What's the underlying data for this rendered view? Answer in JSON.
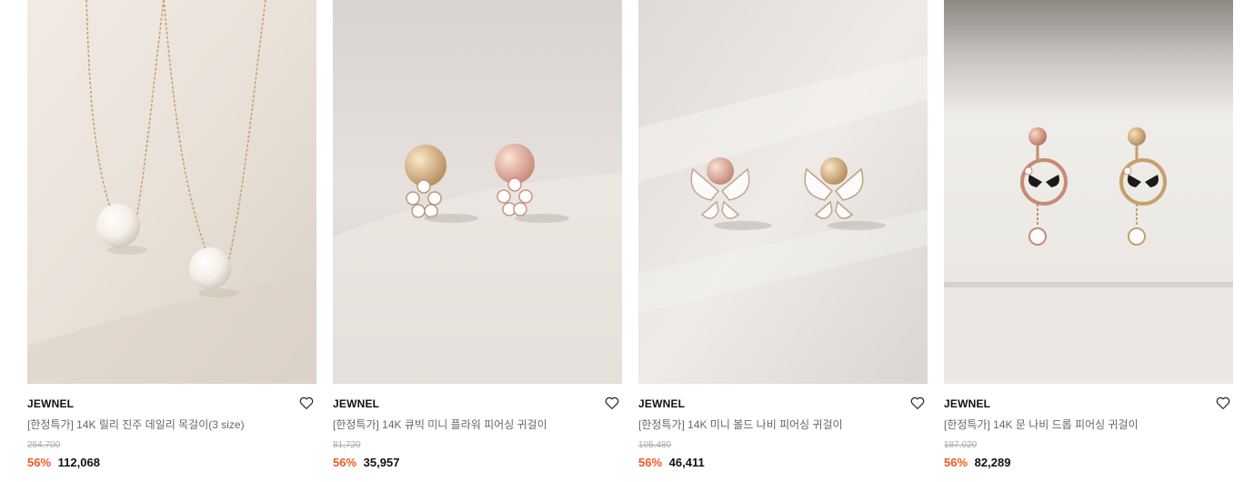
{
  "products": [
    {
      "brand": "JEWNEL",
      "name": "[한정특가] 14K 릴리 진주 데일리 목걸이(3 size)",
      "original_price": "254,700",
      "discount": "56%",
      "price": "112,068",
      "image": "pearl-necklace"
    },
    {
      "brand": "JEWNEL",
      "name": "[한정특가] 14K 큐빅 미니 플라워 피어싱 귀걸이",
      "original_price": "81,720",
      "discount": "56%",
      "price": "35,957",
      "image": "flower-earrings"
    },
    {
      "brand": "JEWNEL",
      "name": "[한정특가] 14K 미니 볼드 나비 피어싱 귀걸이",
      "original_price": "105,480",
      "discount": "56%",
      "price": "46,411",
      "image": "butterfly-earrings"
    },
    {
      "brand": "JEWNEL",
      "name": "[한정특가] 14K 문 나비 드롭 피어싱 귀걸이",
      "original_price": "187,020",
      "discount": "56%",
      "price": "82,289",
      "image": "moon-butterfly-drop-earrings"
    }
  ],
  "colors": {
    "discount": "#f05a1e",
    "brand": "#111111",
    "name": "#666666",
    "original_price": "#aaaaaa"
  },
  "icons": {
    "wishlist": "heart-outline-icon"
  }
}
